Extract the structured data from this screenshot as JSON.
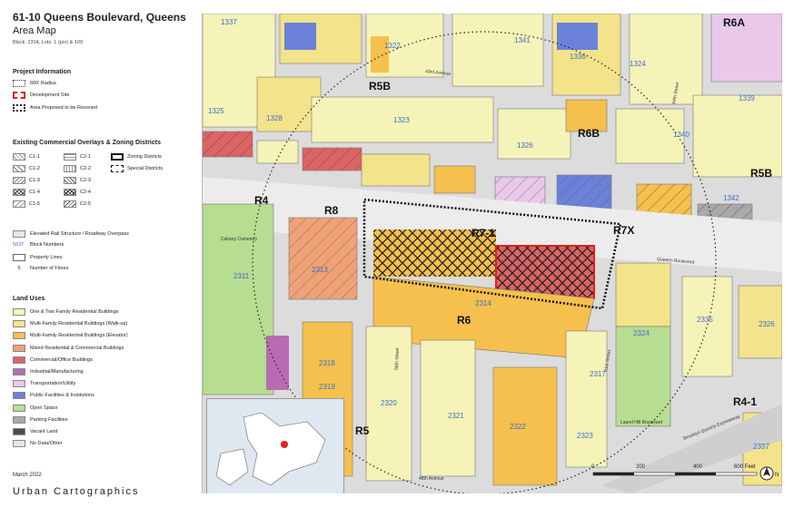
{
  "header": {
    "title": "61-10 Queens Boulevard, Queens",
    "subtitle": "Area Map",
    "meta": "Block: 2314, Lots: 1 (p/o) & 100"
  },
  "project_info": {
    "heading": "Project Information",
    "items": [
      {
        "label": "600' Radius",
        "style": "dotted"
      },
      {
        "label": "Development Site",
        "style": "red-dashed"
      },
      {
        "label": "Area Proposed to be Rezoned",
        "style": "heavy-dotted"
      }
    ]
  },
  "overlays": {
    "heading": "Existing Commercial Overlays & Zoning Districts",
    "c1": [
      "C1-1",
      "C1-2",
      "C1-3",
      "C1-4",
      "C1-5"
    ],
    "c2": [
      "C2-1",
      "C2-2",
      "C2-3",
      "C2-4",
      "C2-5"
    ],
    "zoning_districts": "Zoning Districts",
    "special_districts": "Special Districts"
  },
  "misc_legend": {
    "elevated": "Elevated Rail Structure / Roadway Overpass",
    "block_numbers_sample": "5637",
    "block_numbers": "Block Numbers",
    "property_lines": "Property Lines",
    "floors_sample": "5",
    "floors": "Number of Floors"
  },
  "land_uses": {
    "heading": "Land Uses",
    "items": [
      {
        "label": "One & Two Family Residential Buildings",
        "color": "#f6f3b8"
      },
      {
        "label": "Multi-Family Residential Buildings (Walk-up)",
        "color": "#f3e38a"
      },
      {
        "label": "Multi-Family Residential Buildings (Elevator)",
        "color": "#f5c04e"
      },
      {
        "label": "Mixed Residential & Commercial Buildings",
        "color": "#f0a277"
      },
      {
        "label": "Commercial/Office Buildings",
        "color": "#dc6464"
      },
      {
        "label": "Industrial/Manufacturing",
        "color": "#b86bb3"
      },
      {
        "label": "Transportation/Utility",
        "color": "#e9c8ea"
      },
      {
        "label": "Public Facilities & Institutions",
        "color": "#6b82d8"
      },
      {
        "label": "Open Space",
        "color": "#b7dd91"
      },
      {
        "label": "Parking Facilities",
        "color": "#a9a9a9"
      },
      {
        "label": "Vacant Land",
        "color": "#4d4d4d"
      },
      {
        "label": "No Data/Other",
        "color": "#e6e6e6"
      }
    ]
  },
  "footer": {
    "date": "March 2022",
    "brand": "Urban Cartographics"
  },
  "map": {
    "zoning_labels": [
      "R6A",
      "R5B",
      "R6B",
      "R5B",
      "R4",
      "R8",
      "R7-1",
      "R7X",
      "R6",
      "R5",
      "R4-1"
    ],
    "blocks": [
      "1337",
      "1322",
      "1341",
      "1336",
      "1324",
      "1325",
      "1323",
      "1340",
      "1328",
      "1326",
      "1339",
      "1342",
      "2311",
      "2313",
      "2314",
      "2324",
      "2318",
      "2319",
      "2320",
      "2321",
      "2317",
      "2322",
      "2323",
      "2337",
      "2335",
      "2326"
    ],
    "streets": [
      "43rd Avenue",
      "Queens Boulevard",
      "Laurel Hill Boulevard",
      "Brooklyn Queens Expressway",
      "48th Avenue",
      "58th Street",
      "61st Street",
      "64th Street",
      "Calvary Cemetery"
    ],
    "scale": [
      "0",
      "200",
      "400",
      "600 Feet"
    ],
    "north": "N"
  }
}
